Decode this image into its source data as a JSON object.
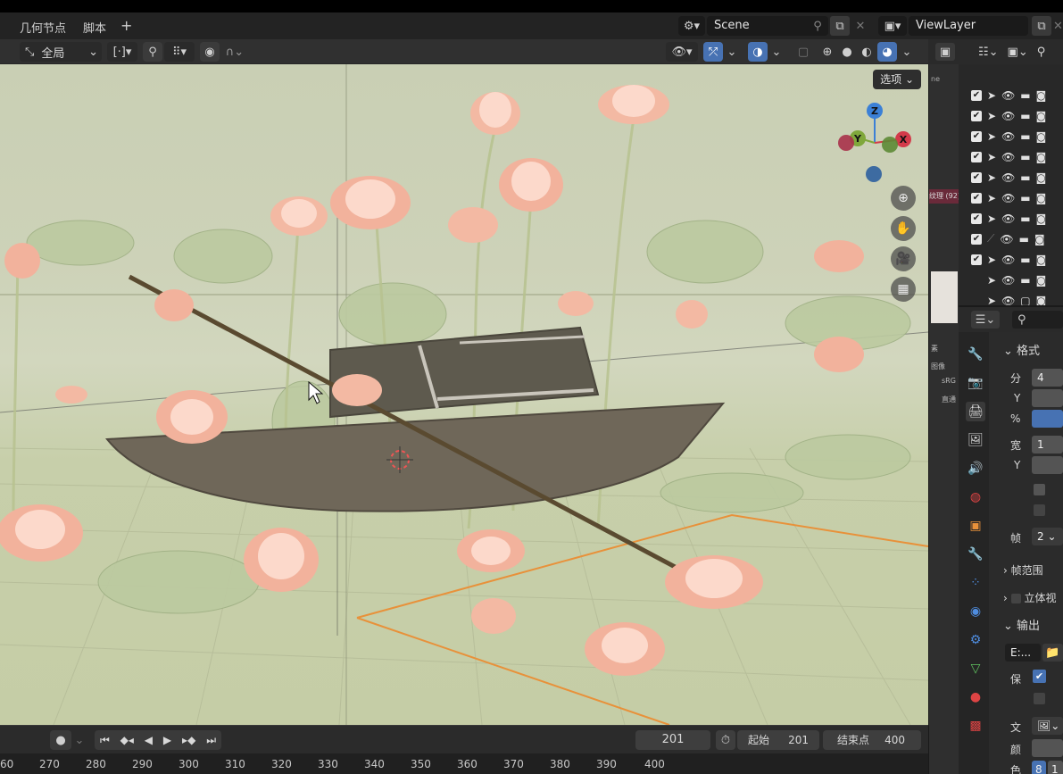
{
  "menubar": {
    "items": [
      "几何节点",
      "脚本"
    ],
    "add": "+",
    "scene_label": "Scene",
    "viewlayer_label": "ViewLayer"
  },
  "header": {
    "transform": "全局",
    "options_label": "选项"
  },
  "gizmo": {
    "z": "Z",
    "y": "Y",
    "x": "X"
  },
  "timeline": {
    "current_frame": "201",
    "start_label": "起始",
    "start_value": "201",
    "end_label": "结束点",
    "end_value": "400"
  },
  "frame_ruler": [
    "60",
    "270",
    "280",
    "290",
    "300",
    "310",
    "320",
    "330",
    "340",
    "350",
    "360",
    "370",
    "380",
    "390",
    "400"
  ],
  "strip": {
    "ne": "ne",
    "tex": "纹理 (92)",
    "s1": "素",
    "s2": "图像",
    "srgb": "sRG",
    "lin": "直通"
  },
  "props": {
    "section_format": "格式",
    "res_label": "分",
    "res_value": "4",
    "y_label": "Y",
    "pct_label": "%",
    "aspect_label": "宽",
    "aspect_value": "1",
    "y2_label": "Y",
    "fps_label": "帧",
    "fps_value": "2",
    "frame_range": "帧范围",
    "stereo": "立体视",
    "output": "输出",
    "path_value": "E:...",
    "save_label": "保",
    "file_label": "文",
    "color_label": "颜",
    "color2_label": "色",
    "color2_value": "8",
    "color2_value2": "1"
  },
  "colors": {
    "accent": "#4772b3",
    "bg": "#1d1d1d",
    "panel": "#2b2b2b"
  }
}
